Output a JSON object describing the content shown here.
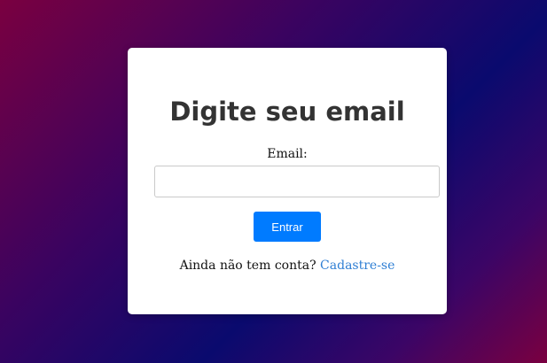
{
  "login": {
    "title": "Digite seu email",
    "email_label": "Email:",
    "email_value": "",
    "submit_label": "Entrar",
    "signup_prompt": "Ainda não tem conta?",
    "signup_link": "Cadastre-se"
  },
  "colors": {
    "button": "#007bff",
    "link": "#2f7fd4",
    "title": "#333333",
    "background_start": "#7a0040",
    "background_mid": "#0a0a6e"
  }
}
